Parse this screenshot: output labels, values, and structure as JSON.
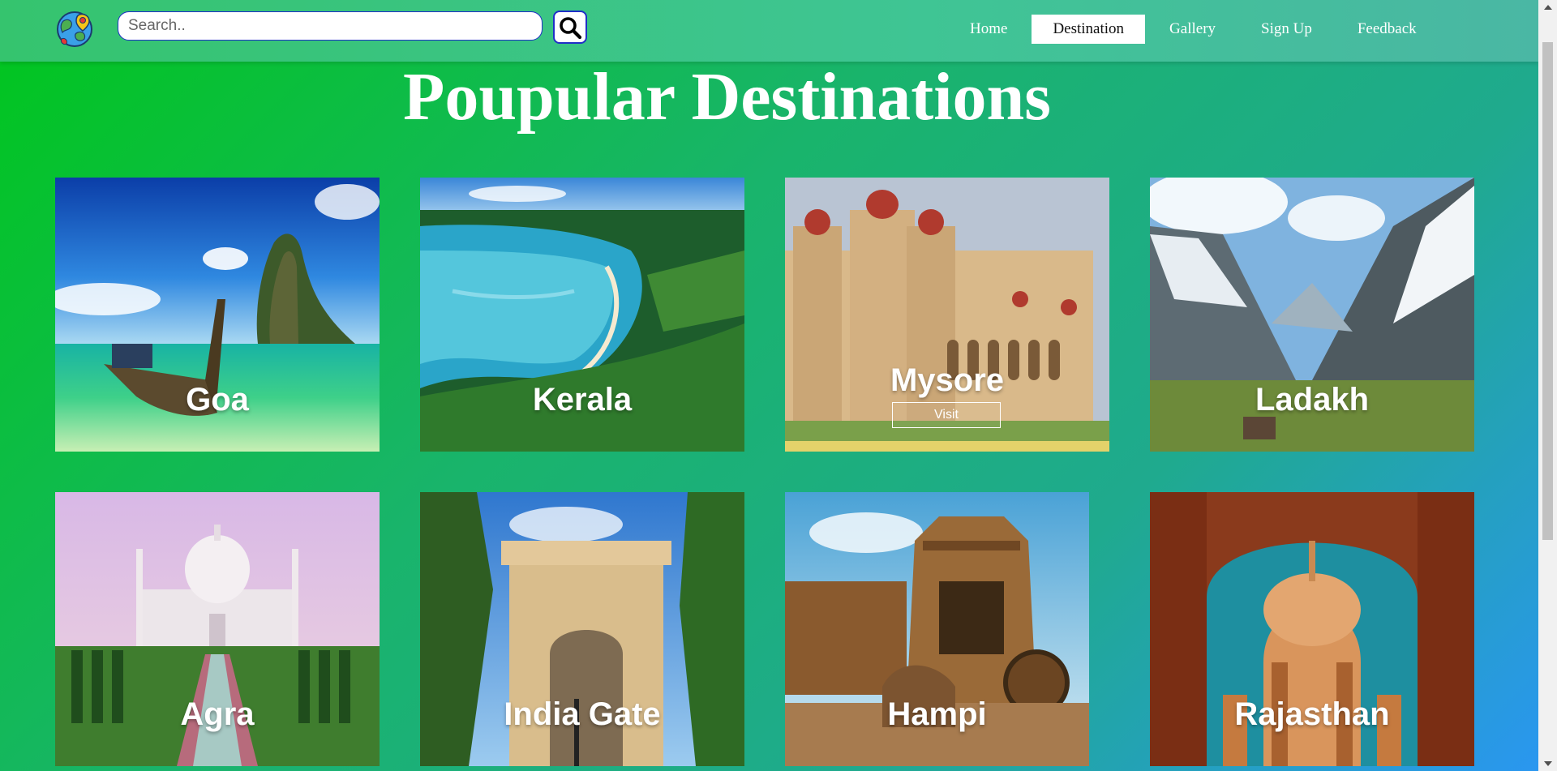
{
  "header": {
    "logo_icon": "globe-travel-icon",
    "search": {
      "placeholder": "Search..",
      "value": "",
      "button_icon": "search-icon"
    },
    "nav": [
      {
        "label": "Home",
        "active": false
      },
      {
        "label": "Destination",
        "active": true
      },
      {
        "label": "Gallery",
        "active": false
      },
      {
        "label": "Sign Up",
        "active": false
      },
      {
        "label": "Feedback",
        "active": false
      }
    ]
  },
  "main": {
    "title": "Poupular Destinations",
    "destinations": [
      {
        "name": "Goa",
        "scene": "beach-longtail-boat-limestone-rock"
      },
      {
        "name": "Kerala",
        "scene": "coastal-bay-green-hills"
      },
      {
        "name": "Mysore",
        "scene": "mysore-palace",
        "hovered": true,
        "button_label": "Visit"
      },
      {
        "name": "Ladakh",
        "scene": "snowy-mountain-valley"
      },
      {
        "name": "Agra",
        "scene": "taj-mahal-gardens"
      },
      {
        "name": "India Gate",
        "scene": "india-gate-trees"
      },
      {
        "name": "Hampi",
        "scene": "stone-chariot-temple"
      },
      {
        "name": "Rajasthan",
        "scene": "cenotaph-arch"
      }
    ]
  },
  "colors": {
    "brand_green": "#00c61c",
    "gradient_blue": "#2a96f3",
    "navbar": "#3fc594",
    "search_border": "#1f2ec7",
    "text_light": "#ffffff"
  }
}
